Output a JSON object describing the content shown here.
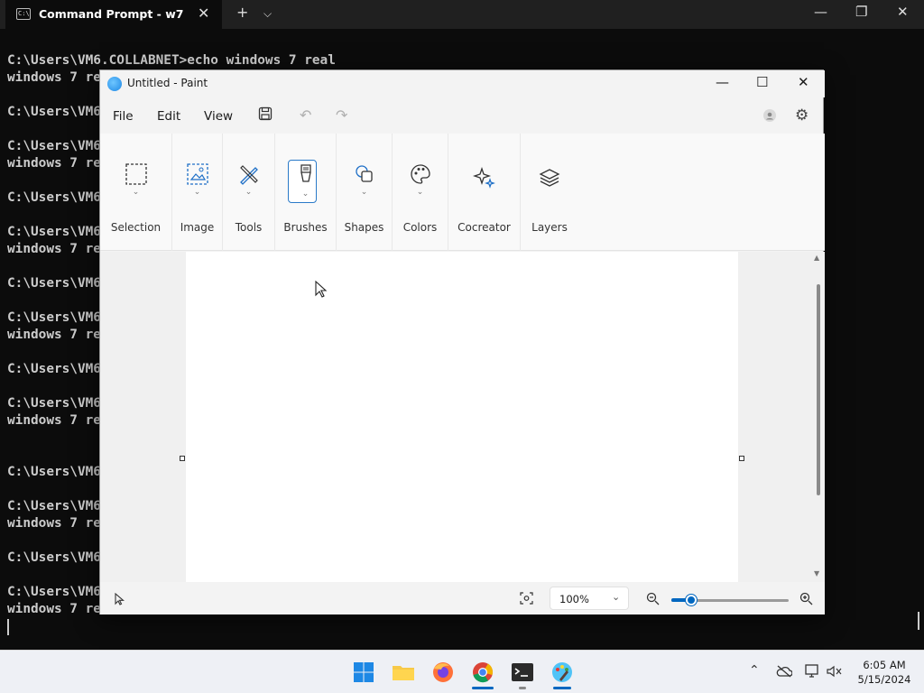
{
  "terminal": {
    "tab_title": "Command Prompt - w7",
    "tab_icon": "cmd-icon",
    "lines": [
      "C:\\Users\\VM6.COLLABNET>echo windows 7 real",
      "windows 7 real",
      "",
      "C:\\Users\\VM6",
      "",
      "C:\\Users\\VM6",
      "windows 7 re",
      "",
      "C:\\Users\\VM6",
      "",
      "C:\\Users\\VM6",
      "windows 7 re",
      "",
      "C:\\Users\\VM6",
      "",
      "C:\\Users\\VM6",
      "windows 7 re",
      "",
      "C:\\Users\\VM6",
      "",
      "C:\\Users\\VM6",
      "windows 7 re",
      "",
      "",
      "C:\\Users\\VM6",
      "",
      "C:\\Users\\VM6",
      "windows 7 re",
      "",
      "C:\\Users\\VM6",
      "",
      "C:\\Users\\VM6",
      "windows 7 re"
    ],
    "text_block": "C:\\Users\\VM6.COLLABNET>echo windows 7 real\nwindows 7 real\n\nC:\\Users\\VM6\n\nC:\\Users\\VM6\nwindows 7 re\n\nC:\\Users\\VM6\n\nC:\\Users\\VM6\nwindows 7 re\n\nC:\\Users\\VM6\n\nC:\\Users\\VM6\nwindows 7 re\n\nC:\\Users\\VM6\n\nC:\\Users\\VM6\nwindows 7 re\n\n\nC:\\Users\\VM6\n\nC:\\Users\\VM6\nwindows 7 re\n\nC:\\Users\\VM6\n\nC:\\Users\\VM6\nwindows 7 re"
  },
  "paint": {
    "title": "Untitled - Paint",
    "menu": {
      "file": "File",
      "edit": "Edit",
      "view": "View"
    },
    "toolbar_groups": [
      {
        "label": "Selection",
        "icon": "selection-icon"
      },
      {
        "label": "Image",
        "icon": "image-icon"
      },
      {
        "label": "Tools",
        "icon": "tools-icon"
      },
      {
        "label": "Brushes",
        "icon": "brush-icon"
      },
      {
        "label": "Shapes",
        "icon": "shapes-icon"
      },
      {
        "label": "Colors",
        "icon": "palette-icon"
      },
      {
        "label": "Cocreator",
        "icon": "sparkle-icon"
      },
      {
        "label": "Layers",
        "icon": "layers-icon"
      }
    ],
    "zoom": "100%",
    "zoom_level": 1.0
  },
  "taskbar": {
    "time": "6:05 AM",
    "date": "5/15/2024",
    "apps": [
      "start-icon",
      "file-explorer-icon",
      "firefox-icon",
      "chrome-icon",
      "terminal-icon",
      "paint-icon"
    ]
  },
  "colors": {
    "accent": "#0067c0",
    "terminal_bg": "#0c0c0c",
    "terminal_fg": "#cccccc"
  }
}
